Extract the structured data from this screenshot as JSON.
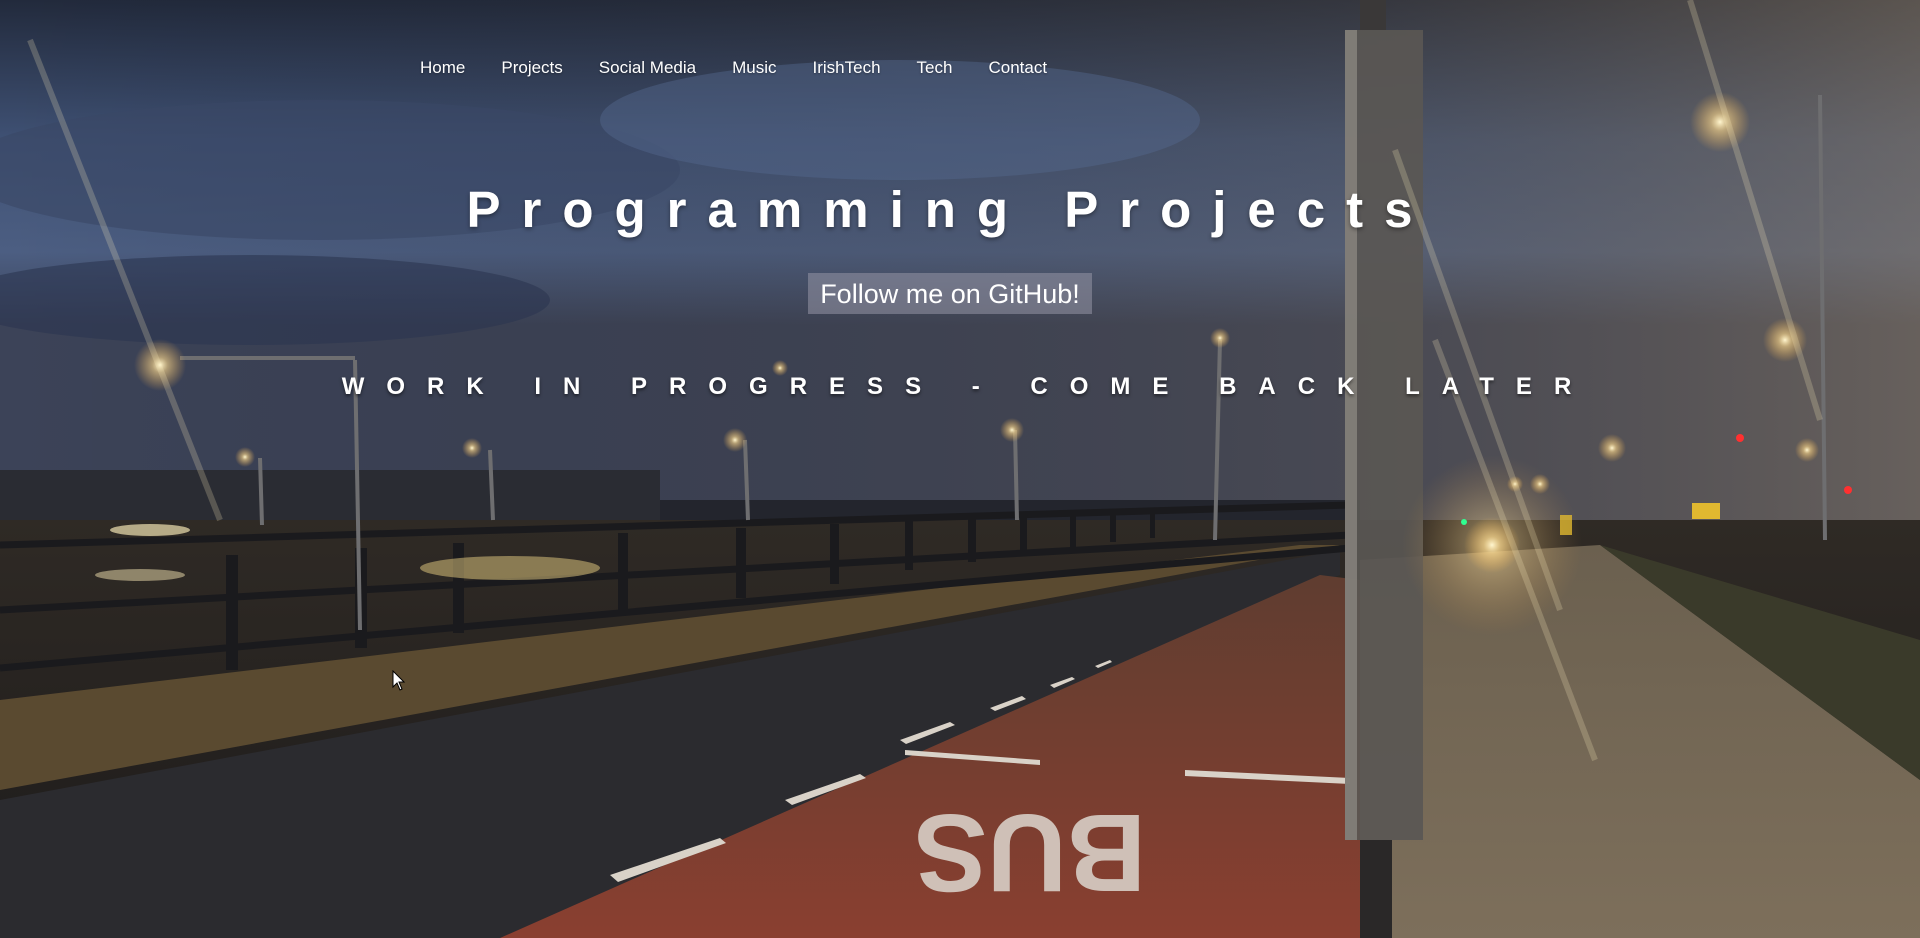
{
  "nav": {
    "items": [
      "Home",
      "Projects",
      "Social Media",
      "Music",
      "IrishTech",
      "Tech",
      "Contact"
    ]
  },
  "hero": {
    "title": "Programming Projects",
    "github_button": "Follow me on GitHub!",
    "notice": "WORK IN PROGRESS - COME BACK LATER"
  },
  "background": {
    "road_marking": "BUS",
    "colors": {
      "sky_top": "#27314a",
      "sky_mid": "#4a5d86",
      "road": "#2c2a2c",
      "bus_lane": "#7a3a2e",
      "streetlight": "#fff3c4"
    }
  }
}
